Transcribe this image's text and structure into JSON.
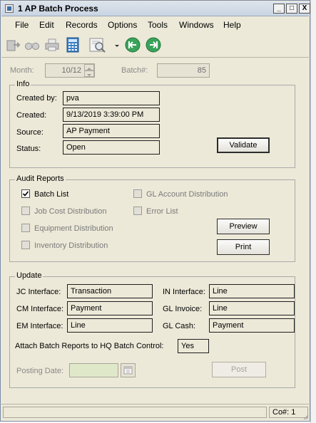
{
  "window": {
    "title": "1 AP Batch Process",
    "controls": {
      "minimize": "_",
      "maximize": "□",
      "close": "X"
    }
  },
  "menu": [
    "File",
    "Edit",
    "Records",
    "Options",
    "Tools",
    "Windows",
    "Help"
  ],
  "toolbar": {
    "icons": [
      "exit-icon",
      "binoculars-icon",
      "printer-icon",
      "calculator-icon",
      "print-preview-icon",
      "dropdown-arrow-icon",
      "first-record-icon",
      "last-record-icon"
    ]
  },
  "header": {
    "month_label": "Month:",
    "month_value": "10/12",
    "batch_label": "Batch#:",
    "batch_value": "85"
  },
  "info": {
    "legend": "Info",
    "created_by_label": "Created by:",
    "created_by": "pva",
    "created_label": "Created:",
    "created": "9/13/2019 3:39:00 PM",
    "source_label": "Source:",
    "source": "AP Payment",
    "status_label": "Status:",
    "status": "Open",
    "validate_button": "Validate"
  },
  "audit_reports": {
    "legend": "Audit Reports",
    "batch_list": {
      "label": "Batch List",
      "checked": true
    },
    "job_cost": {
      "label": "Job Cost Distribution",
      "checked": false
    },
    "equipment": {
      "label": "Equipment Distribution",
      "checked": false
    },
    "inventory": {
      "label": "Inventory Distribution",
      "checked": false
    },
    "gl_account": {
      "label": "GL Account Distribution",
      "checked": false
    },
    "error_list": {
      "label": "Error List",
      "checked": false
    },
    "preview_button": "Preview",
    "print_button": "Print"
  },
  "update": {
    "legend": "Update",
    "jc_label": "JC Interface:",
    "jc_value": "Transaction",
    "cm_label": "CM Interface:",
    "cm_value": "Payment",
    "em_label": "EM Interface:",
    "em_value": "Line",
    "in_label": "IN Interface:",
    "in_value": "Line",
    "gl_invoice_label": "GL Invoice:",
    "gl_invoice_value": "Line",
    "gl_cash_label": "GL Cash:",
    "gl_cash_value": "Payment",
    "attach_label": "Attach Batch Reports to HQ Batch Control:",
    "attach_value": "Yes",
    "posting_date_label": "Posting Date:",
    "posting_date_value": "",
    "post_button": "Post"
  },
  "status_bar": {
    "company": "Co#: 1"
  },
  "colors": {
    "window_bg": "#ece9d8",
    "date_field_bg": "#dfe9c9",
    "nav_green": "#3aa35a"
  }
}
